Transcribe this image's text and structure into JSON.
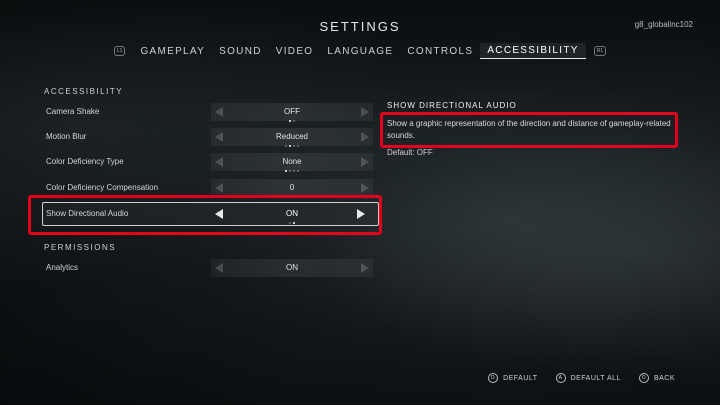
{
  "header": {
    "title": "SETTINGS",
    "username": "g8_globalinc102",
    "left_bumper": "L1",
    "right_bumper": "R1"
  },
  "tabs": [
    {
      "label": "GAMEPLAY"
    },
    {
      "label": "SOUND"
    },
    {
      "label": "VIDEO"
    },
    {
      "label": "LANGUAGE"
    },
    {
      "label": "CONTROLS"
    },
    {
      "label": "ACCESSIBILITY",
      "active": true
    }
  ],
  "sections": {
    "accessibility": "ACCESSIBILITY",
    "permissions": "PERMISSIONS"
  },
  "settings": [
    {
      "label": "Camera Shake",
      "value": "OFF",
      "dots": 2,
      "selected_dot": 0
    },
    {
      "label": "Motion Blur",
      "value": "Reduced",
      "dots": 4,
      "selected_dot": 1
    },
    {
      "label": "Color Deficiency Type",
      "value": "None",
      "dots": 4,
      "selected_dot": 0
    },
    {
      "label": "Color Deficiency Compensation",
      "value": "0",
      "dots": 0,
      "selected_dot": -1
    },
    {
      "label": "Show Directional Audio",
      "value": "ON",
      "dots": 2,
      "selected_dot": 1,
      "selected": true
    }
  ],
  "permissions": [
    {
      "label": "Analytics",
      "value": "ON",
      "dots": 0,
      "selected_dot": -1
    }
  ],
  "detail": {
    "title": "SHOW DIRECTIONAL AUDIO",
    "description": "Show a graphic representation of the direction and distance of gameplay-related sounds.",
    "default": "Default: OFF"
  },
  "footer": {
    "default_btn": "DEFAULT",
    "default_all_btn": "DEFAULT ALL",
    "back_btn": "BACK",
    "default_icon": "D",
    "default_all_icon": "A",
    "back_icon": "O"
  },
  "colors": {
    "highlight": "#e3001a"
  }
}
